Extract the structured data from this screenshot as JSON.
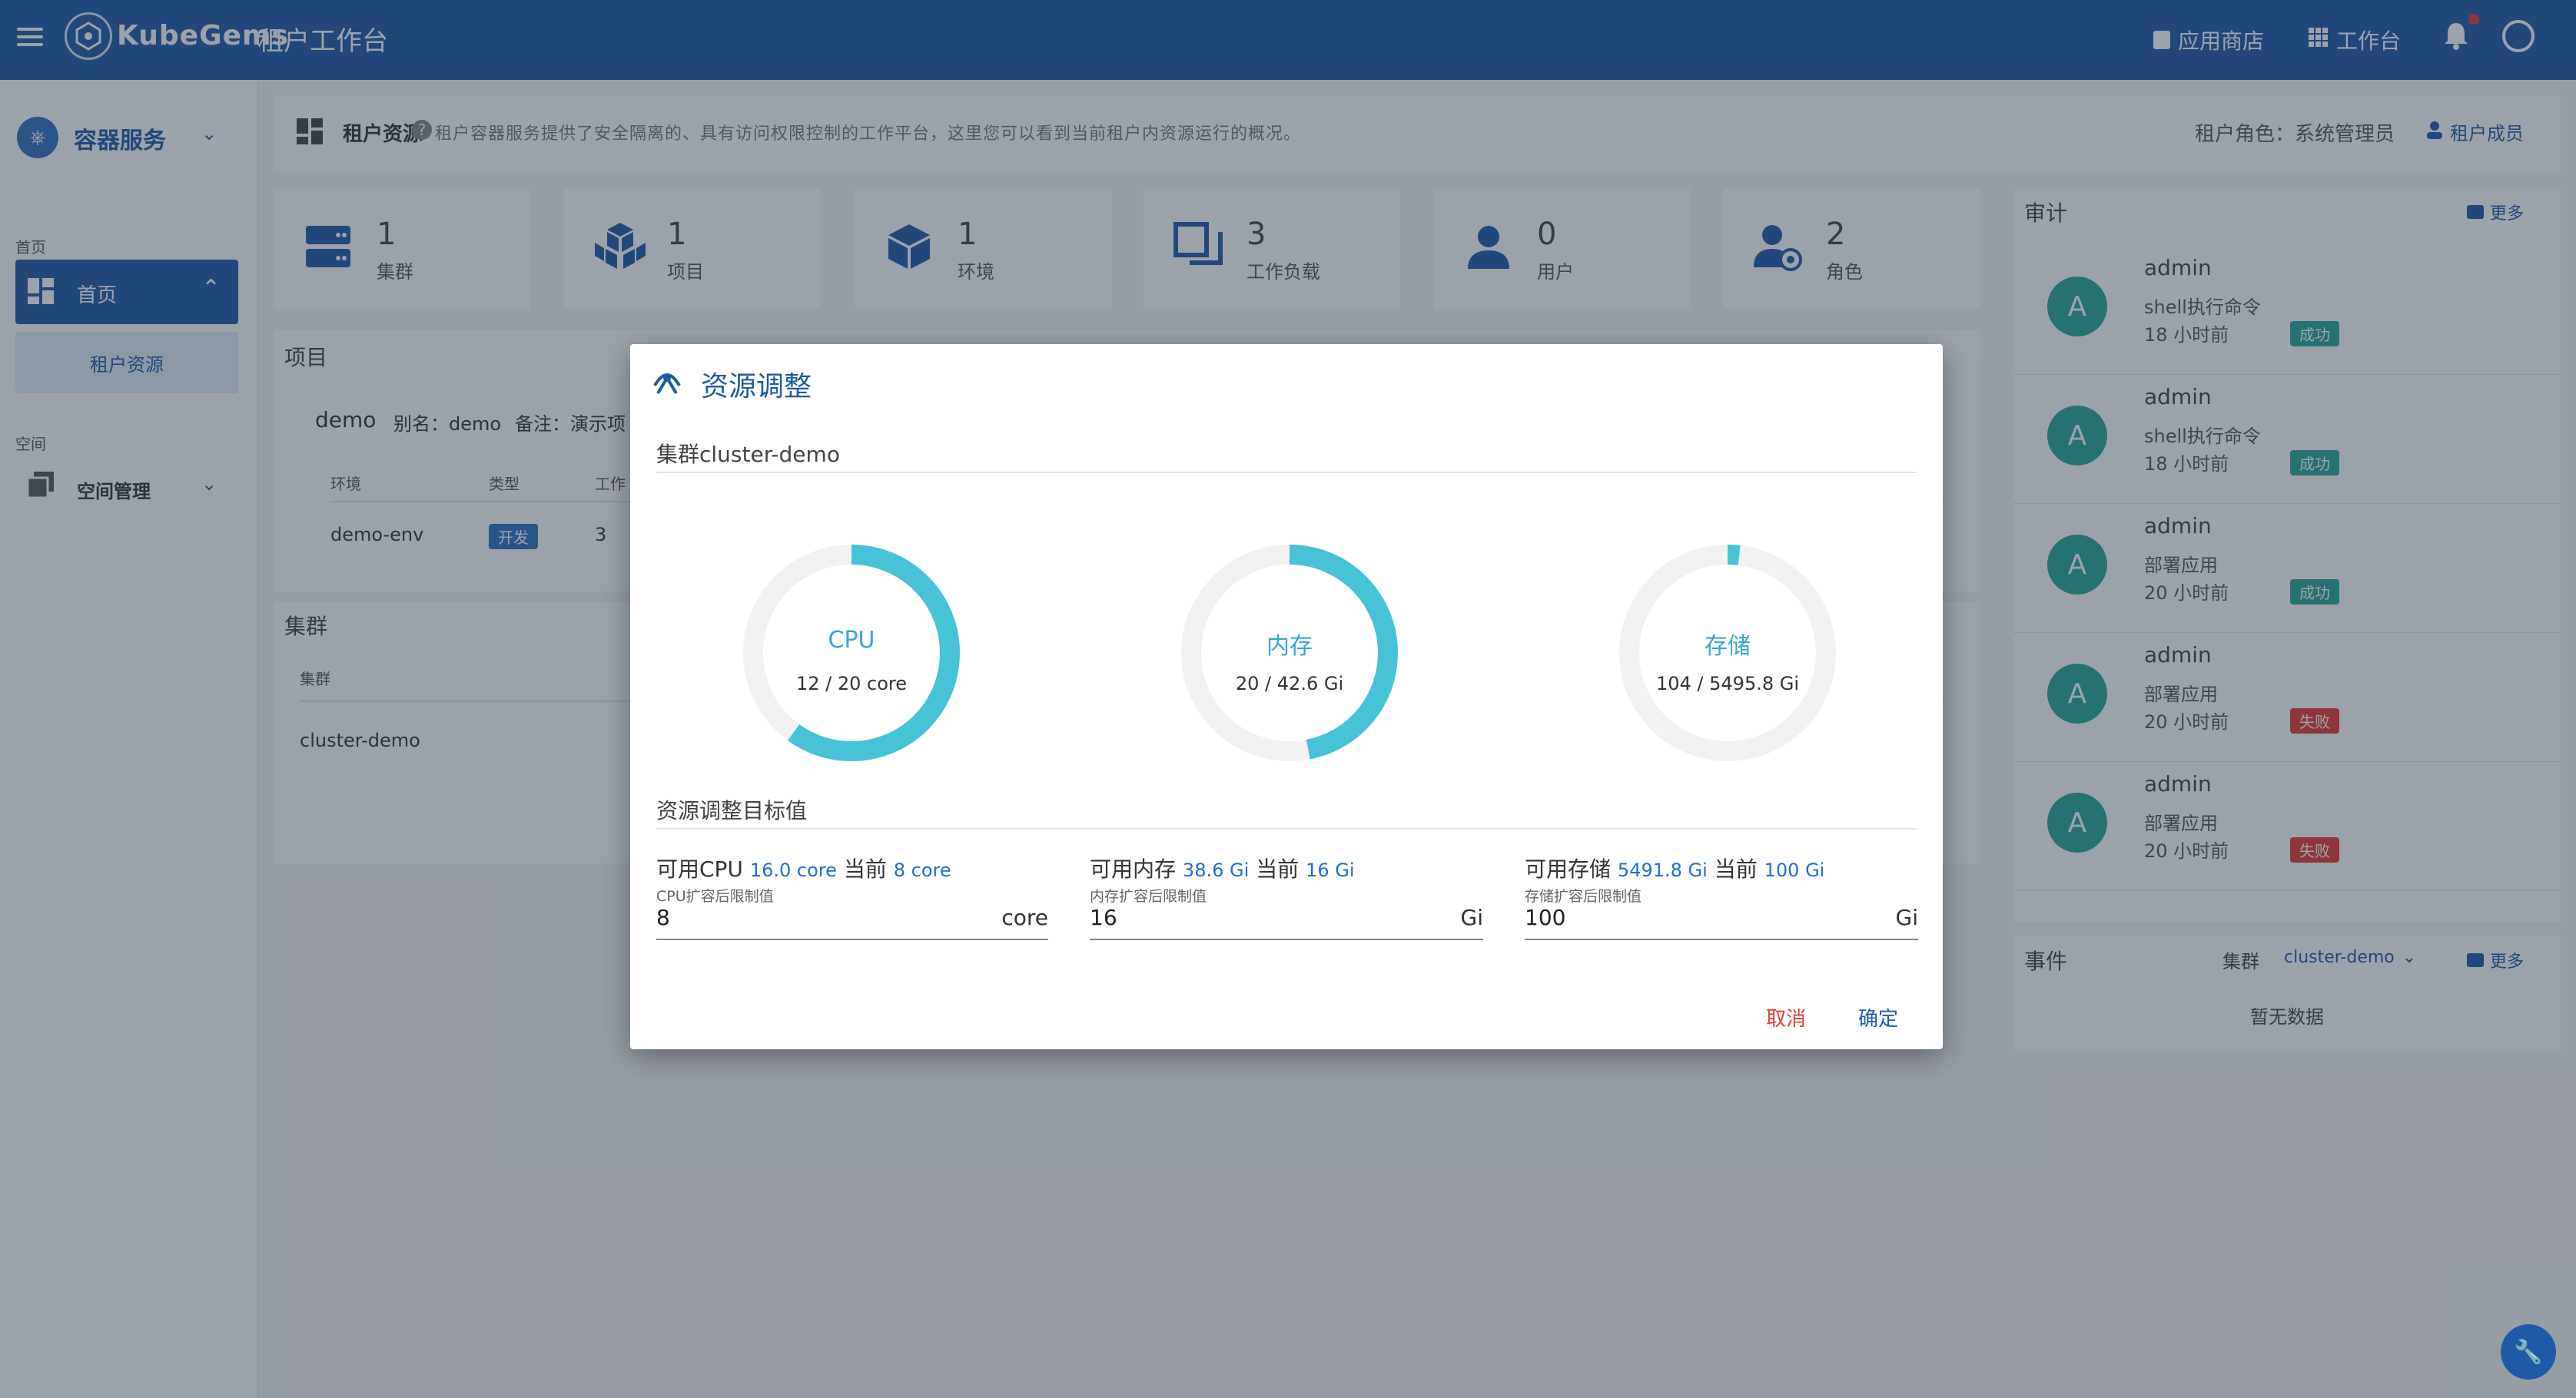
{
  "app": {
    "name": "KubeGems",
    "subtitle": "租户工作台"
  },
  "topbar": {
    "app_store": "应用商店",
    "workbench": "工作台"
  },
  "sidebar": {
    "service": "容器服务",
    "sections": [
      {
        "label": "首页",
        "items": [
          {
            "label": "首页",
            "sub": [
              "租户资源"
            ]
          }
        ]
      },
      {
        "label": "空间",
        "items": [
          {
            "label": "空间管理"
          }
        ]
      }
    ]
  },
  "header": {
    "title": "租户资源",
    "desc": "租户容器服务提供了安全隔离的、具有访问权限控制的工作平台，这里您可以看到当前租户内资源运行的概况。",
    "role": "租户角色：系统管理员",
    "members": "租户成员"
  },
  "stats": [
    {
      "num": "1",
      "label": "集群"
    },
    {
      "num": "1",
      "label": "项目"
    },
    {
      "num": "1",
      "label": "环境"
    },
    {
      "num": "3",
      "label": "工作负载"
    },
    {
      "num": "0",
      "label": "用户"
    },
    {
      "num": "2",
      "label": "角色"
    }
  ],
  "project": {
    "title": "项目",
    "name": "demo",
    "alias": "别名：demo",
    "note": "备注：演示项",
    "columns": [
      "环境",
      "类型",
      "工作"
    ],
    "row": {
      "env": "demo-env",
      "type": "开发",
      "workload": "3"
    }
  },
  "cluster": {
    "title": "集群",
    "column": "集群",
    "row": "cluster-demo"
  },
  "audit": {
    "title": "审计",
    "more": "更多",
    "items": [
      {
        "avatar": "A",
        "user": "admin",
        "op": "shell执行命令",
        "time": "18 小时前",
        "status": "成功"
      },
      {
        "avatar": "A",
        "user": "admin",
        "op": "shell执行命令",
        "time": "18 小时前",
        "status": "成功"
      },
      {
        "avatar": "A",
        "user": "admin",
        "op": "部署应用",
        "time": "20 小时前",
        "status": "成功"
      },
      {
        "avatar": "A",
        "user": "admin",
        "op": "部署应用",
        "time": "20 小时前",
        "status": "失败"
      },
      {
        "avatar": "A",
        "user": "admin",
        "op": "部署应用",
        "time": "20 小时前",
        "status": "失败"
      }
    ]
  },
  "events": {
    "title": "事件",
    "cluster_label": "集群",
    "cluster": "cluster-demo",
    "more": "更多",
    "empty": "暂无数据"
  },
  "dialog": {
    "title": "资源调整",
    "cluster": "集群cluster-demo",
    "rings": [
      {
        "label": "CPU",
        "value": "12 / 20 core",
        "used": 12,
        "total": 20
      },
      {
        "label": "内存",
        "value": "20 / 42.6 Gi",
        "used": 20,
        "total": 42.6
      },
      {
        "label": "存储",
        "value": "104 / 5495.8 Gi",
        "used": 104,
        "total": 5495.8
      }
    ],
    "target_title": "资源调整目标值",
    "fields": [
      {
        "avail_label": "可用CPU",
        "avail": "16.0 core",
        "cur_label": "当前",
        "cur": "8 core",
        "hint": "CPU扩容后限制值",
        "value": "8",
        "unit": "core"
      },
      {
        "avail_label": "可用内存",
        "avail": "38.6 Gi",
        "cur_label": "当前",
        "cur": "16 Gi",
        "hint": "内存扩容后限制值",
        "value": "16",
        "unit": "Gi"
      },
      {
        "avail_label": "可用存储",
        "avail": "5491.8 Gi",
        "cur_label": "当前",
        "cur": "100 Gi",
        "hint": "存储扩容后限制值",
        "value": "100",
        "unit": "Gi"
      }
    ],
    "cancel": "取消",
    "ok": "确定"
  },
  "colors": {
    "primary": "#1f5aa6",
    "ring": "#47c3d8",
    "success": "#26a69a",
    "fail": "#e53935"
  }
}
